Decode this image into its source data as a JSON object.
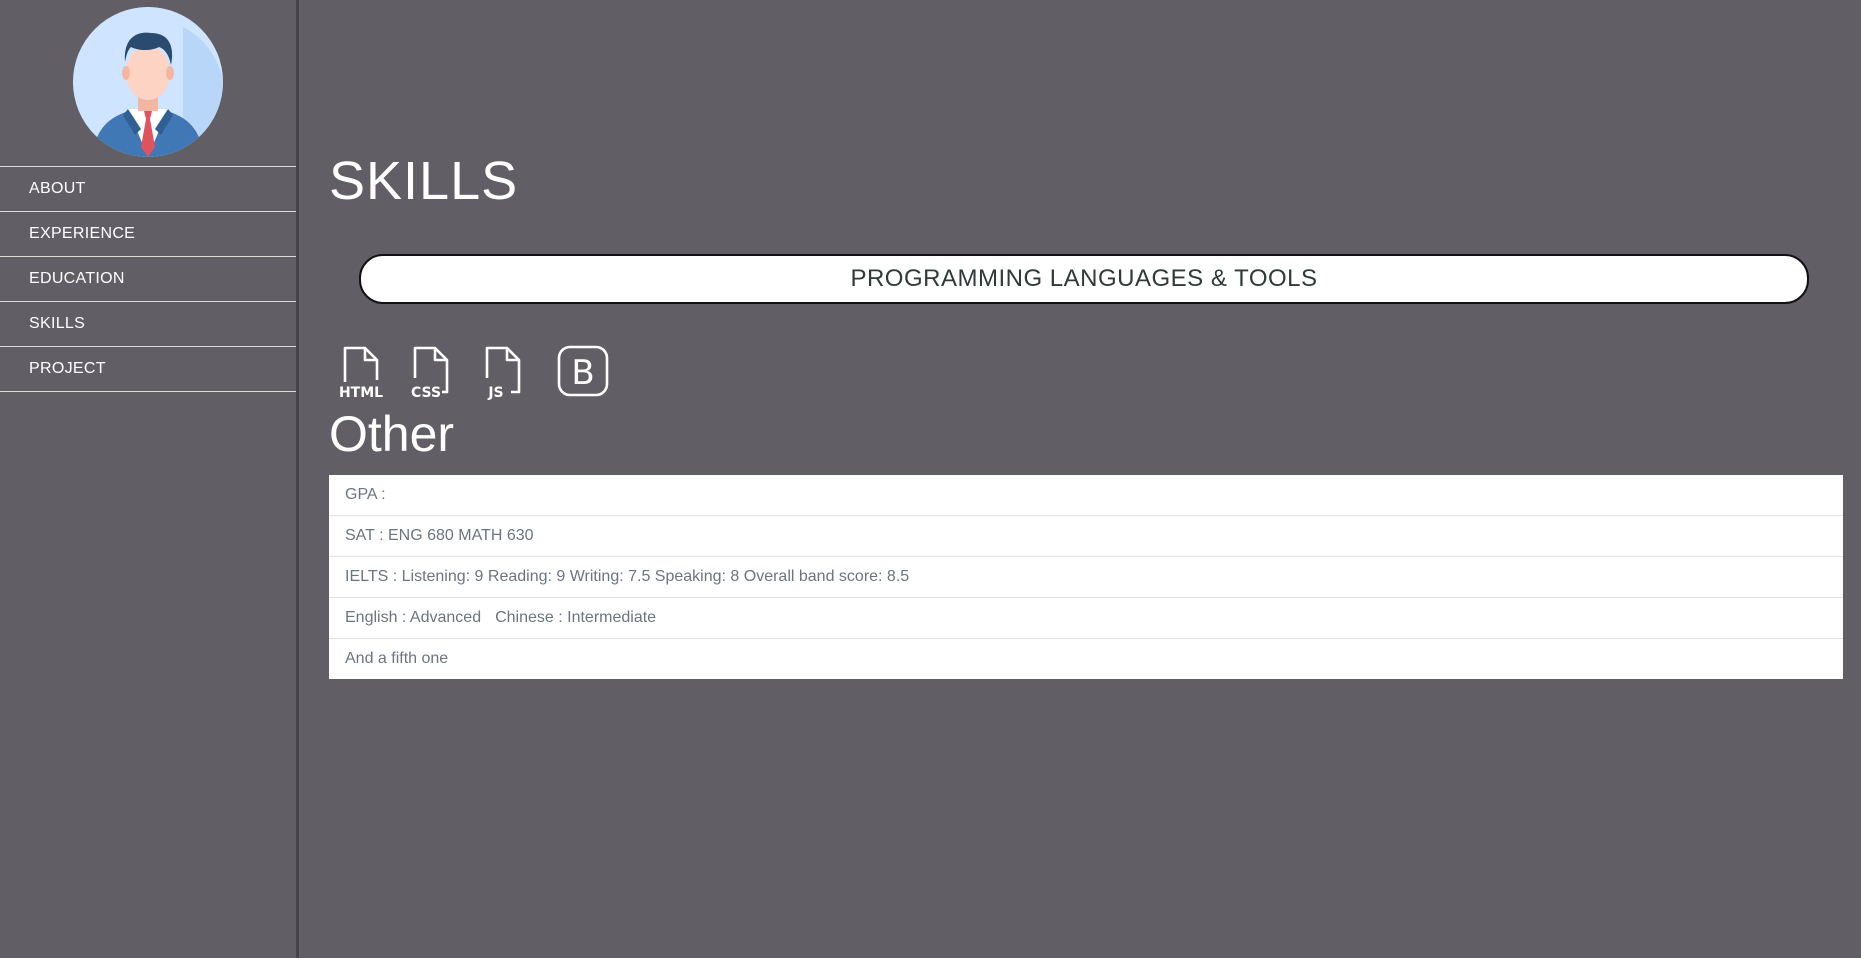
{
  "sidebar": {
    "nav": [
      {
        "label": "ABOUT"
      },
      {
        "label": "EXPERIENCE"
      },
      {
        "label": "EDUCATION"
      },
      {
        "label": "SKILLS"
      },
      {
        "label": "PROJECT"
      }
    ]
  },
  "main": {
    "title": "SKILLS",
    "section_heading": "PROGRAMMING LANGUAGES & TOOLS",
    "skill_icons": [
      {
        "name": "html-file-icon",
        "label": "HTML"
      },
      {
        "name": "css-file-icon",
        "label": "CSS"
      },
      {
        "name": "js-file-icon",
        "label": "JS"
      },
      {
        "name": "bootstrap-icon",
        "label": "B"
      }
    ],
    "other_heading": "Other",
    "other_items": [
      {
        "text": "GPA :"
      },
      {
        "text": "SAT : ENG 680 MATH 630"
      },
      {
        "text": "IELTS : Listening: 9 Reading: 9 Writing: 7.5 Speaking: 8 Overall band score: 8.5"
      },
      {
        "text_a": "English : Advanced",
        "text_b": "Chinese : Intermediate"
      },
      {
        "text": "And a fifth one"
      }
    ]
  },
  "colors": {
    "background": "#615f65",
    "text_light": "#ffffff",
    "list_text": "#6c757d",
    "pill_text": "#2e3b38"
  }
}
